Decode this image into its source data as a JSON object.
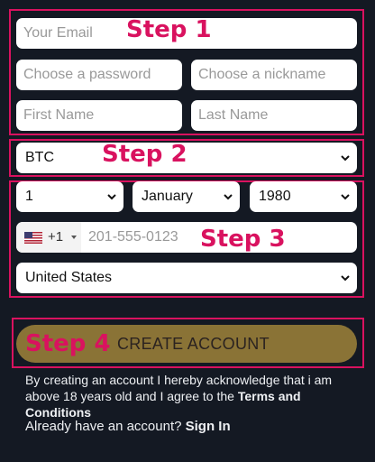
{
  "steps": [
    "Step 1",
    "Step 2",
    "Step 3",
    "Step 4"
  ],
  "step1": {
    "email_placeholder": "Your Email",
    "password_placeholder": "Choose a password",
    "nickname_placeholder": "Choose a nickname",
    "first_name_placeholder": "First Name",
    "last_name_placeholder": "Last Name"
  },
  "step2": {
    "currency": "BTC"
  },
  "step3": {
    "day": "1",
    "month": "January",
    "year": "1980",
    "phone_code": "+1",
    "phone_placeholder": "201-555-0123",
    "country": "United States",
    "flag_icon": "us-flag-icon"
  },
  "step4": {
    "button_label": "CREATE ACCOUNT"
  },
  "legal": {
    "text_before": "By creating an account I hereby acknowledge that i am above 18 years old and I agree to the ",
    "terms_link": "Terms and Conditions"
  },
  "signin": {
    "prompt": "Already have an account? ",
    "link": "Sign In"
  },
  "colors": {
    "background": "#141923",
    "step_highlight": "#d9125f",
    "button": "#8a7336"
  }
}
